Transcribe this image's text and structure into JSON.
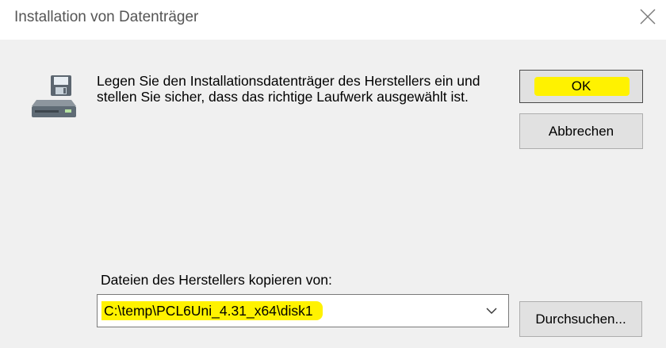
{
  "window": {
    "title": "Installation von Datenträger",
    "close_icon": "close-icon"
  },
  "message": {
    "icon": "disk-drive-icon",
    "text": "Legen Sie den Installationsdatenträger des Herstellers ein und stellen Sie sicher, dass das richtige Laufwerk ausgewählt ist."
  },
  "buttons": {
    "ok_label": "OK",
    "cancel_label": "Abbrechen",
    "browse_label": "Durchsuchen..."
  },
  "copy_from": {
    "label": "Dateien des Herstellers kopieren von:",
    "value": "C:\\temp\\PCL6Uni_4.31_x64\\disk1",
    "dropdown_icon": "chevron-down-icon"
  },
  "colors": {
    "highlight": "#fff200",
    "dialog_background": "#f0f0f0",
    "button_background": "#e1e1e1"
  }
}
